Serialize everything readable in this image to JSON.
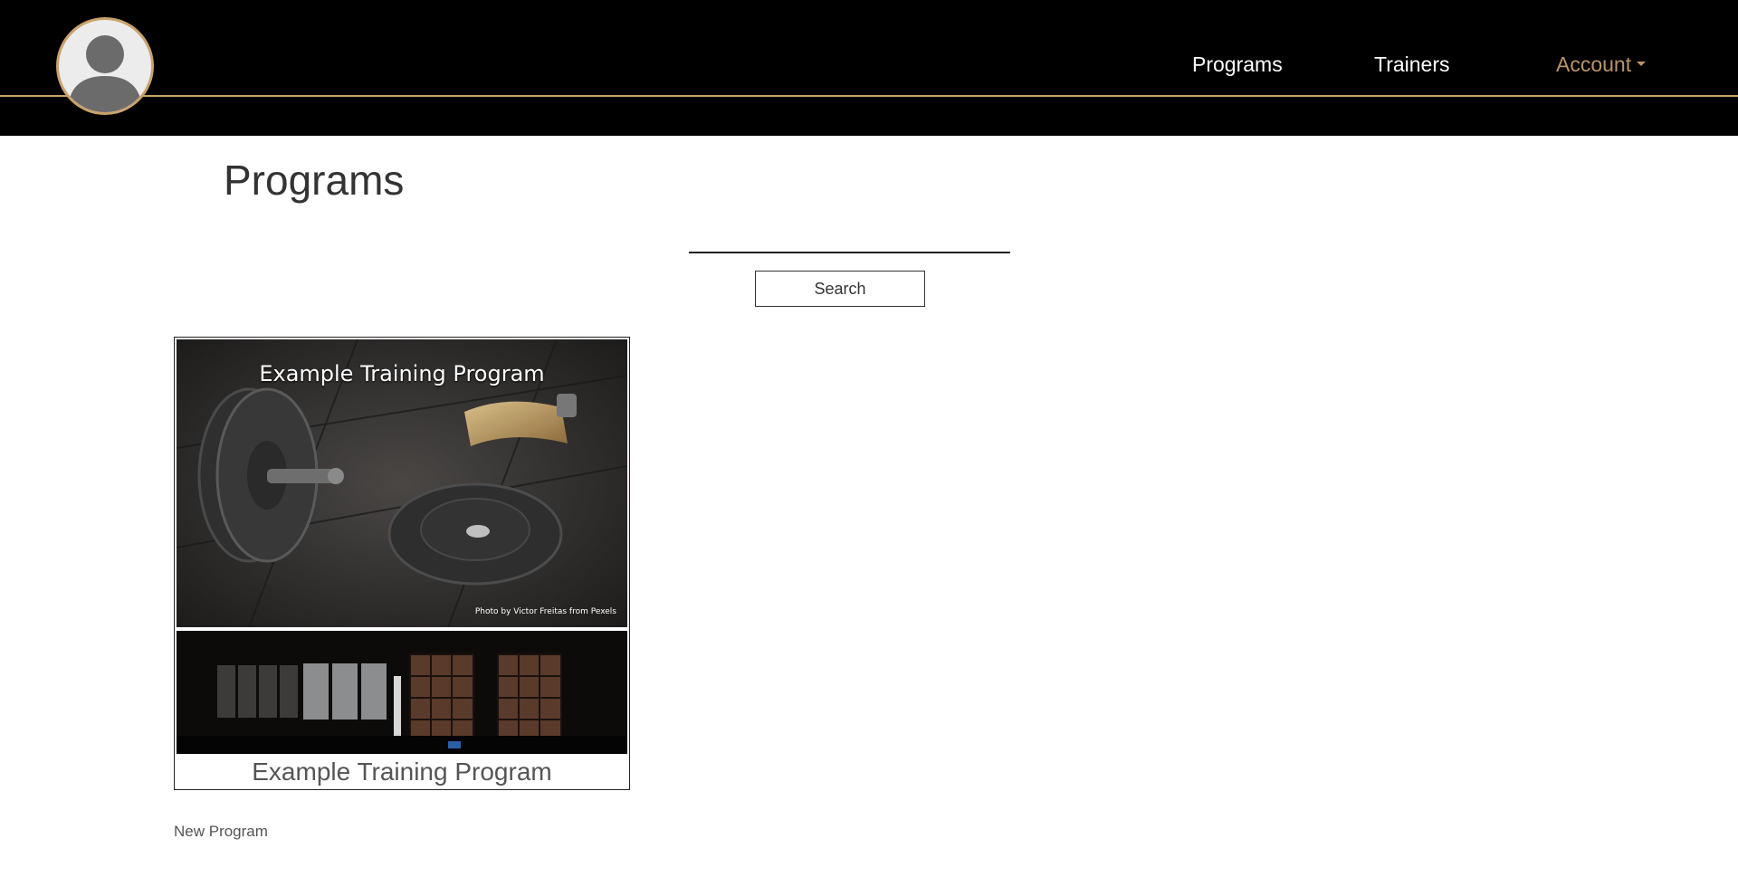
{
  "header": {
    "avatar_alt": "user-avatar",
    "nav": {
      "programs_label": "Programs",
      "trainers_label": "Trainers",
      "account_label": "Account"
    },
    "colors": {
      "background": "#000000",
      "accent": "#c9a26b",
      "account_link": "#b8946a"
    }
  },
  "main": {
    "page_title": "Programs",
    "search": {
      "value": "",
      "button_label": "Search"
    },
    "programs": [
      {
        "image_title": "Example Training Program",
        "image_credit": "Photo by Victor Freitas from Pexels",
        "caption": "Example Training Program"
      }
    ],
    "new_program_label": "New Program"
  }
}
